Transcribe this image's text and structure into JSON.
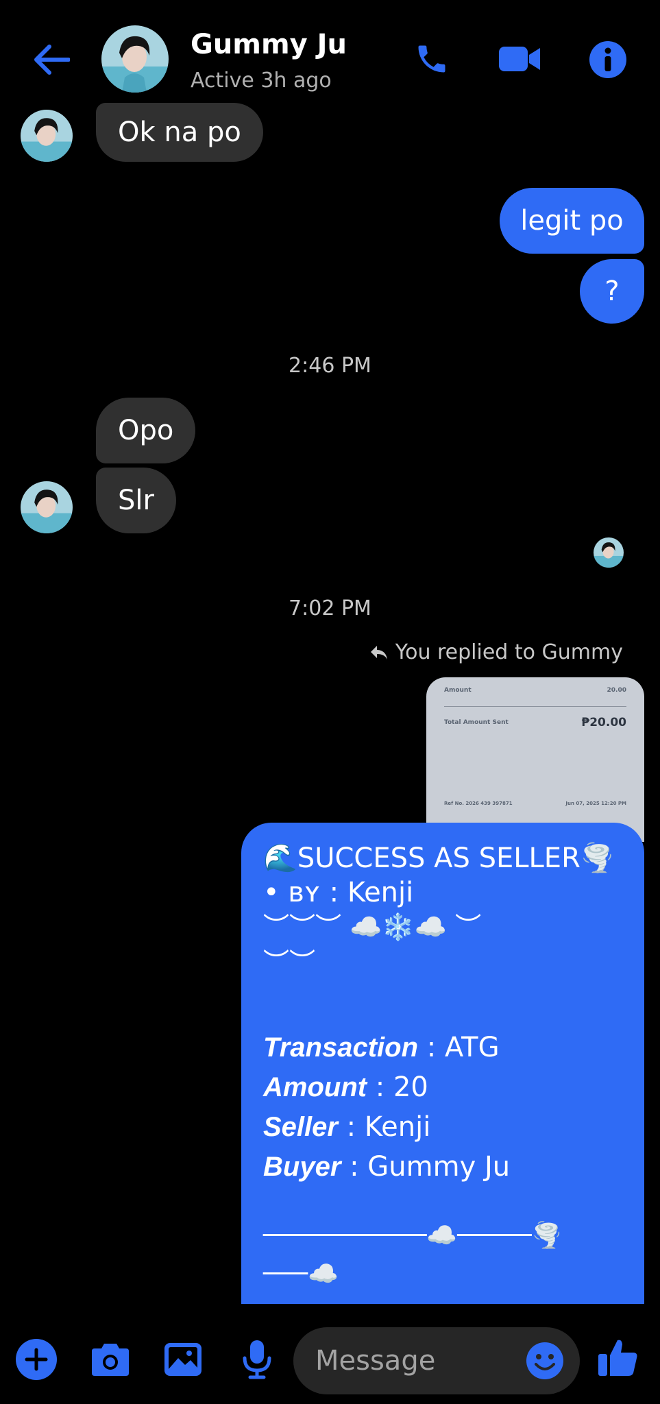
{
  "header": {
    "contact_name": "Gummy Ju",
    "status": "Active 3h ago"
  },
  "messages": {
    "m1": "Ok na po",
    "m2": "legit po",
    "m3": "?",
    "t1": "2:46 PM",
    "m4": "Opo",
    "m5": "Slr",
    "t2": "7:02 PM",
    "reply_note": "You replied to Gummy"
  },
  "reply_preview": {
    "amount_label": "Amount",
    "amount_value": "20.00",
    "total_label": "Total Amount Sent",
    "total_value": "₱20.00",
    "ref_label": "Ref No. 2026 439 397871",
    "date_value": "Jun 07, 2025 12:20 PM"
  },
  "card": {
    "title": "🌊SUCCESS AS SELLER🌪️",
    "by_line": "• ʙʏ : Kenji",
    "deco1": "︶︶︶ ☁️❄️☁️ ︶",
    "deco2": "︶︶",
    "transaction_label": "Transaction",
    "transaction_value": " : ATG",
    "amount_label": "Amount",
    "amount_value": " : 20",
    "seller_label": "Seller",
    "seller_value": " : Kenji",
    "buyer_label": "Buyer",
    "buyer_value": " : Gummy Ju",
    "divider1": "───────────☁️─────🌪️",
    "divider2": "───☁️"
  },
  "composer": {
    "placeholder": "Message"
  },
  "colors": {
    "accent": "#2f6bf5",
    "incoming_bubble": "#303030",
    "background": "#000000"
  },
  "icons": [
    "back-arrow-icon",
    "phone-icon",
    "video-camera-icon",
    "info-icon",
    "plus-icon",
    "camera-icon",
    "image-icon",
    "microphone-icon",
    "emoji-icon",
    "thumbs-up-icon",
    "reply-icon"
  ]
}
